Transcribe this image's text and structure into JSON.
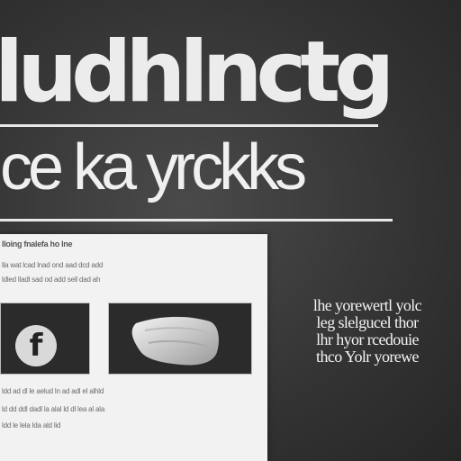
{
  "headline": "ludhlnctg",
  "subhead": "ce ka yrckks",
  "panel": {
    "title": "lloing fnalefa ho lne",
    "lines_top": [
      "lla wat lcad lnad ond aad dcd add",
      "ldled lladl sad od add sell dad ah"
    ],
    "lines_bottom": [
      "ldd ad dl le aelud ln ad adl el alhld",
      "ld dd ddl dadl la alal ld dl lea al ala",
      "ldd le lela lda ald lid"
    ],
    "left_image_icon": "facebook-f-icon",
    "left_image_glyph": "f",
    "right_image_icon": "pillow-cloth-image"
  },
  "side_caption": [
    "lhe yorewertl yolc",
    "leg slelgucel thor",
    "lhr hyor rcedouie",
    "thco Yolr yorewe"
  ]
}
